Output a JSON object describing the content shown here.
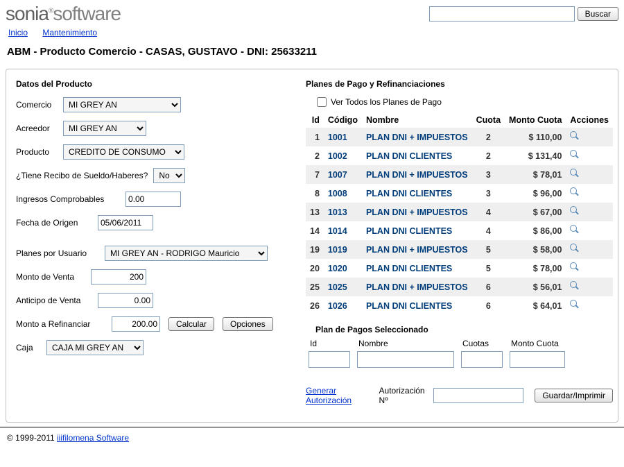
{
  "brand": {
    "first": "sonia",
    "sup": "®",
    "second": "software"
  },
  "search": {
    "placeholder": "",
    "value": "",
    "button": "Buscar"
  },
  "nav": {
    "home": "Inicio",
    "maint": "Mantenimiento"
  },
  "title": "ABM - Producto Comercio - CASAS, GUSTAVO - DNI: 25633211",
  "left": {
    "section": "Datos del Producto",
    "comercio_label": "Comercio",
    "comercio_value": "MI GREY AN",
    "acreedor_label": "Acreedor",
    "acreedor_value": "MI GREY AN",
    "producto_label": "Producto",
    "producto_value": "CREDITO DE CONSUMO",
    "recibo_label": "¿Tiene Recibo de Sueldo/Haberes?",
    "recibo_value": "No",
    "ingresos_label": "Ingresos Comprobables",
    "ingresos_value": "0.00",
    "fecha_label": "Fecha de Origen",
    "fecha_value": "05/06/2011",
    "planes_usuario_label": "Planes por Usuario",
    "planes_usuario_value": "MI GREY AN - RODRIGO Mauricio",
    "monto_venta_label": "Monto de Venta",
    "monto_venta_value": "200",
    "anticipo_label": "Anticipo de Venta",
    "anticipo_value": "0.00",
    "monto_refin_label": "Monto a Refinanciar",
    "monto_refin_value": "200.00",
    "calcular_btn": "Calcular",
    "opciones_btn": "Opciones",
    "caja_label": "Caja",
    "caja_value": "CAJA MI GREY AN"
  },
  "right": {
    "section": "Planes de Pago y Refinanciaciones",
    "vertodos_label": "Ver Todos los Planes de Pago",
    "headers": {
      "id": "Id",
      "codigo": "Código",
      "nombre": "Nombre",
      "cuota": "Cuota",
      "monto": "Monto Cuota",
      "acciones": "Acciones"
    },
    "rows": [
      {
        "id": "1",
        "codigo": "1001",
        "nombre": "PLAN DNI + IMPUESTOS",
        "cuota": "2",
        "monto": "$ 110,00"
      },
      {
        "id": "2",
        "codigo": "1002",
        "nombre": "PLAN DNI CLIENTES",
        "cuota": "2",
        "monto": "$ 131,40"
      },
      {
        "id": "7",
        "codigo": "1007",
        "nombre": "PLAN DNI + IMPUESTOS",
        "cuota": "3",
        "monto": "$ 78,01"
      },
      {
        "id": "8",
        "codigo": "1008",
        "nombre": "PLAN DNI CLIENTES",
        "cuota": "3",
        "monto": "$ 96,00"
      },
      {
        "id": "13",
        "codigo": "1013",
        "nombre": "PLAN DNI + IMPUESTOS",
        "cuota": "4",
        "monto": "$ 67,00"
      },
      {
        "id": "14",
        "codigo": "1014",
        "nombre": "PLAN DNI CLIENTES",
        "cuota": "4",
        "monto": "$ 86,00"
      },
      {
        "id": "19",
        "codigo": "1019",
        "nombre": "PLAN DNI + IMPUESTOS",
        "cuota": "5",
        "monto": "$ 58,00"
      },
      {
        "id": "20",
        "codigo": "1020",
        "nombre": "PLAN DNI CLIENTES",
        "cuota": "5",
        "monto": "$ 78,00"
      },
      {
        "id": "25",
        "codigo": "1025",
        "nombre": "PLAN DNI + IMPUESTOS",
        "cuota": "6",
        "monto": "$ 56,01"
      },
      {
        "id": "26",
        "codigo": "1026",
        "nombre": "PLAN DNI CLIENTES",
        "cuota": "6",
        "monto": "$ 64,01"
      }
    ],
    "selected_title": "Plan de Pagos Seleccionado",
    "sel": {
      "id": "Id",
      "nombre": "Nombre",
      "cuotas": "Cuotas",
      "monto": "Monto Cuota"
    },
    "generar": "Generar Autorización",
    "autoriz_label": "Autorización  Nº",
    "guardar_btn": "Guardar/Imprimir"
  },
  "footer": {
    "copy": "© 1999-2011 ",
    "link": "iiifilomena Software"
  }
}
